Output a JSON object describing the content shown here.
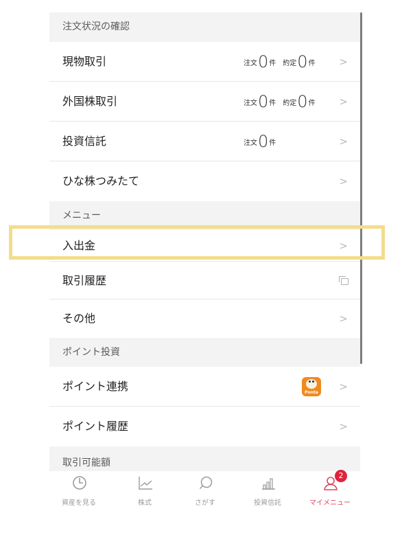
{
  "sections": {
    "orders": {
      "header": "注文状況の確認",
      "rows": [
        {
          "label": "現物取引",
          "order_label": "注文",
          "order_count": "0",
          "order_unit": "件",
          "exec_label": "約定",
          "exec_count": "0",
          "exec_unit": "件"
        },
        {
          "label": "外国株取引",
          "order_label": "注文",
          "order_count": "0",
          "order_unit": "件",
          "exec_label": "約定",
          "exec_count": "0",
          "exec_unit": "件"
        },
        {
          "label": "投資信託",
          "order_label": "注文",
          "order_count": "0",
          "order_unit": "件"
        },
        {
          "label": "ひな株つみたて"
        }
      ]
    },
    "menu": {
      "header": "メニュー",
      "rows": [
        {
          "label": "入出金"
        },
        {
          "label": "取引履歴",
          "icon": "external-window-icon"
        },
        {
          "label": "その他"
        }
      ]
    },
    "points": {
      "header": "ポイント投資",
      "rows": [
        {
          "label": "ポイント連携",
          "badge_icon": "ponta-icon",
          "badge_text": "Ponta"
        },
        {
          "label": "ポイント履歴"
        }
      ]
    },
    "tradable": {
      "header": "取引可能額"
    }
  },
  "chevron": ">",
  "tabbar": {
    "tabs": [
      {
        "label": "資産を見る",
        "icon": "clock-icon"
      },
      {
        "label": "株式",
        "icon": "line-chart-icon"
      },
      {
        "label": "さがす",
        "icon": "search-bubble-icon"
      },
      {
        "label": "投資信託",
        "icon": "bar-chart-icon"
      },
      {
        "label": "マイメニュー",
        "icon": "person-icon",
        "badge": "2",
        "active": true
      }
    ]
  },
  "colors": {
    "highlight": "#f3dc8b",
    "active_tab": "#e0455d",
    "badge": "#e0223b",
    "ponta": "#f08a1e"
  }
}
